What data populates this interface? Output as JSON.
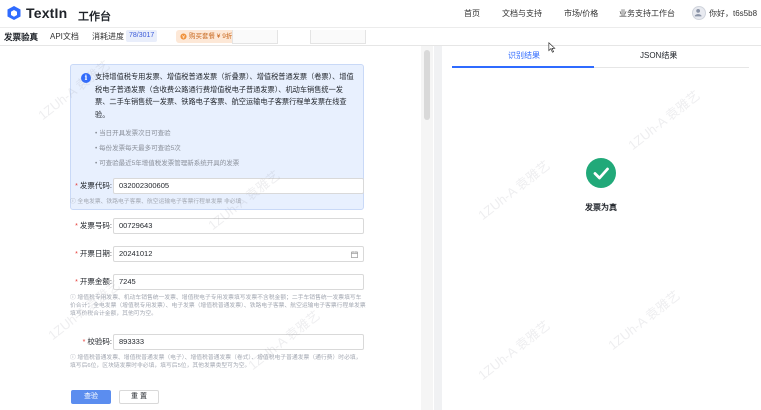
{
  "nav": {
    "brand": "TextIn",
    "workspace": "工作台",
    "links": [
      "首页",
      "文档与支持",
      "市场/价格",
      "业务支持工作台"
    ],
    "user": "你好，t6s5b8"
  },
  "subbar": {
    "page_title": "发票验真",
    "api_doc": "API文档",
    "quota_label": "消耗进度",
    "quota_value": "78/3017",
    "promo": "购买套餐 ¥ 9折起"
  },
  "notice": {
    "main": "支持增值税专用发票、增值税普通发票（折叠票）、增值税普通发票（卷票）、增值税电子普通发票（含收费公路通行费增值税电子普通发票）、机动车销售统一发票、二手车销售统一发票、铁路电子客票、航空运输电子客票行程单发票在线查验。",
    "items": [
      "当日开具发票次日可查验",
      "每份发票每天最多可查验5次",
      "可查验最近5年增值税发票管理新系统开具的发票"
    ]
  },
  "form": {
    "required_mark": "*",
    "invoice_code_label": "发票代码:",
    "invoice_code": "032002300605",
    "invoice_code_hint": "全电发票、铁路电子客票、航空运输电子客票行程单发票 非必填",
    "invoice_number_label": "发票号码:",
    "invoice_number": "00729643",
    "date_label": "开票日期:",
    "date": "20241012",
    "amount_label": "开票金额:",
    "amount": "7245",
    "amount_hint": "增值税专用发票、机动车销售统一发票、增值税电子专用发票填写发票不含税金额；二手车销售统一发票填写车价合计；全电发票（增值税专用发票）、电子发票（增值税普通发票）、铁路电子客票、航空运输电子客票行程单发票填写价税合计金额，其他可为空。",
    "check_code_label": "校验码:",
    "check_code": "893333",
    "check_code_hint": "增值税普通发票、增值税普通发票（电子）、增值税普通发票（卷式）、增值税电子普通发票（通行费）时必填，填写后6位，区块链发票时非必填，填写后5位，其他发票类型可为空。",
    "submit": "查验",
    "reset": "重 置"
  },
  "result": {
    "tab_result": "识别结果",
    "tab_json": "JSON结果",
    "status": "发票为真"
  },
  "colors": {
    "accent": "#2f6bff",
    "success": "#21a979",
    "notice_bg": "#e8f0fe",
    "promo": "#c8681f"
  },
  "watermark": "1ZUh-A 袁雅艺"
}
